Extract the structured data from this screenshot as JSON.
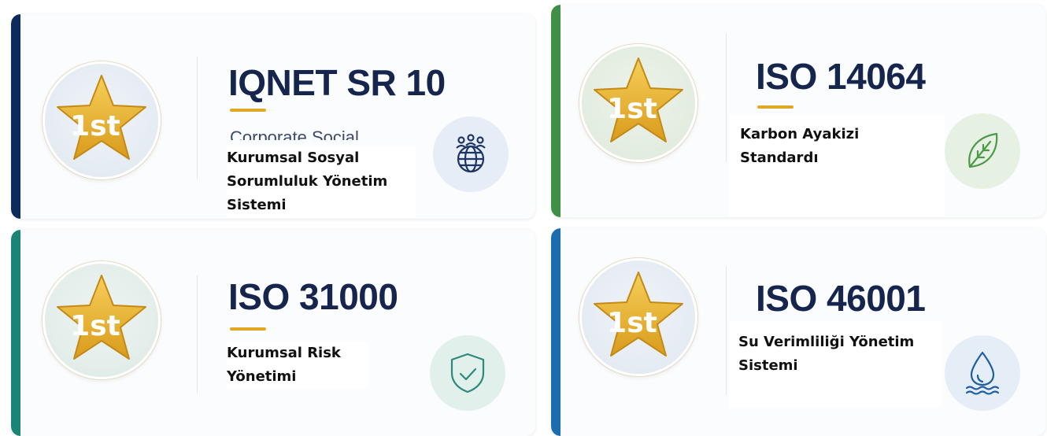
{
  "cards": [
    {
      "title": "IQNET SR 10",
      "ghost_text": "Corporate Social",
      "subtitle": "Kurumsal Sosyal Sorumluluk Yönetim Sistemi",
      "badge_text": "1st",
      "icon": "globe-people-icon",
      "accent_color": "#0d2a5c",
      "icon_bg": "#e6edf6",
      "icon_color": "#1d3565"
    },
    {
      "title": "ISO 14064",
      "subtitle": "Karbon Ayakizi Standardı",
      "badge_text": "1st",
      "icon": "leaf-icon",
      "accent_color": "#3f8f45",
      "icon_bg": "#e6f1e3",
      "icon_color": "#4b9a45"
    },
    {
      "title": "ISO 31000",
      "subtitle": "Kurumsal Risk Yönetimi",
      "badge_text": "1st",
      "icon": "shield-check-icon",
      "accent_color": "#1c8477",
      "icon_bg": "#e2f0ec",
      "icon_color": "#2a8a7b"
    },
    {
      "title": "ISO 46001",
      "subtitle": "Su Verimliliği Yönetim Sistemi",
      "badge_text": "1st",
      "icon": "water-drop-icon",
      "accent_color": "#1c6db0",
      "icon_bg": "#e5eef7",
      "icon_color": "#1e5fa3"
    }
  ]
}
